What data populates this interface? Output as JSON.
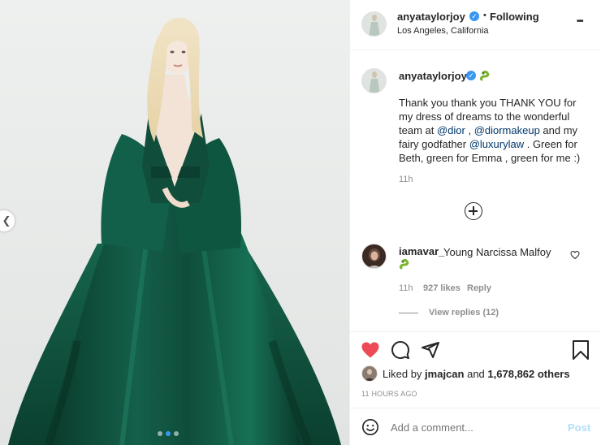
{
  "post": {
    "author": "anyataylorjoy",
    "follow_separator": "•",
    "follow_status": "Following",
    "location": "Los Angeles, California",
    "more_icon": "•••"
  },
  "caption": {
    "author": "anyataylorjoy",
    "emoji": "snake-emoji",
    "segments": [
      {
        "text": "Thank you thank you THANK YOU for my dress of dreams to the wonderful team at ",
        "link": false
      },
      {
        "text": "@dior",
        "link": true
      },
      {
        "text": " , ",
        "link": false
      },
      {
        "text": "@diormakeup",
        "link": true
      },
      {
        "text": " and my fairy godfather ",
        "link": false
      },
      {
        "text": "@luxurylaw",
        "link": true
      },
      {
        "text": " . Green for Beth, green for Emma , green for me :)",
        "link": false
      }
    ],
    "time": "11h"
  },
  "comment": {
    "author": "iamavar_",
    "text": "Young Narcissa Malfoy",
    "time": "11h",
    "likes": "927 likes",
    "reply": "Reply",
    "view_replies": "View replies (12)"
  },
  "likes": {
    "prefix": "Liked by",
    "user": "jmajcan",
    "conjunction": "and",
    "count": "1,678,862 others",
    "timestamp": "11 HOURS AGO"
  },
  "composer": {
    "placeholder": "Add a comment...",
    "post_label": "Post"
  },
  "carousel": {
    "total": 3,
    "active_index": 1
  },
  "colors": {
    "link": "#00376b",
    "heart": "#ed4956",
    "verified": "#3897f0",
    "post_disabled": "#b2dffc",
    "dress": "#0f4a38"
  }
}
